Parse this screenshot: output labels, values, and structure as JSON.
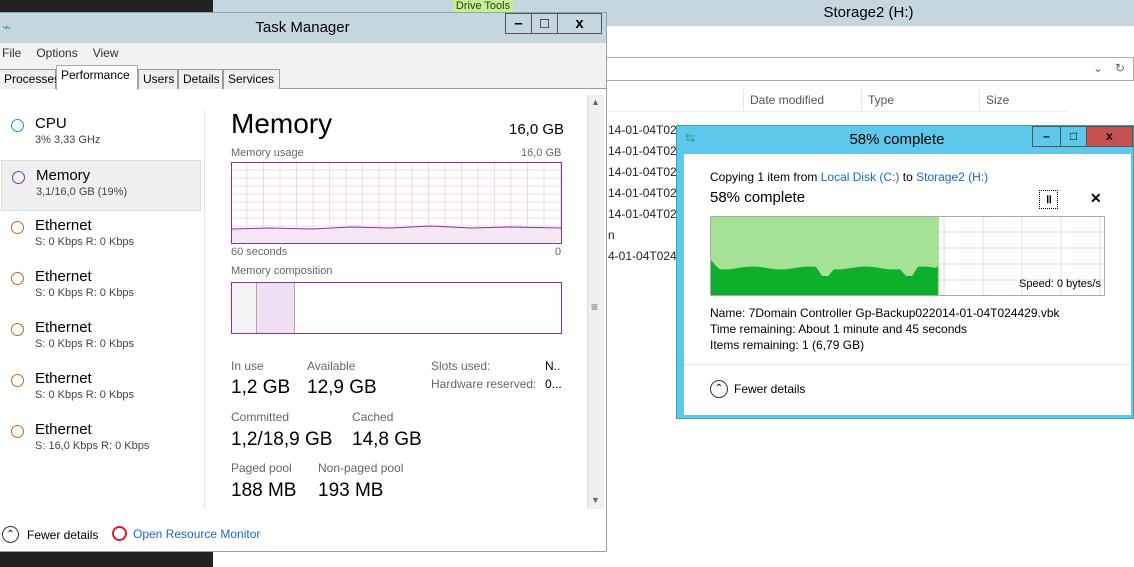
{
  "explorer": {
    "title": "Storage2 (H:)",
    "ribbon_tab": "Drive Tools",
    "columns": [
      "Date modified",
      "Type",
      "Size"
    ],
    "rows": [
      "14-01-04T024",
      "14-01-04T024",
      "14-01-04T024",
      "14-01-04T024",
      "14-01-04T024",
      "n",
      "4-01-04T0244"
    ]
  },
  "task_manager": {
    "title": "Task Manager",
    "menu": [
      "File",
      "Options",
      "View"
    ],
    "tabs": [
      "Processes",
      "Performance",
      "Users",
      "Details",
      "Services"
    ],
    "active_tab": "Performance",
    "sidebar": [
      {
        "name": "CPU",
        "sub": "3% 3,33 GHz",
        "color": "#1b90d8"
      },
      {
        "name": "Memory",
        "sub": "3,1/16,0 GB (19%)",
        "color": "#8b2fa8"
      },
      {
        "name": "Ethernet",
        "sub": "S: 0 Kbps R: 0 Kbps",
        "color": "#c8641e"
      },
      {
        "name": "Ethernet",
        "sub": "S: 0 Kbps R: 0 Kbps",
        "color": "#c8641e"
      },
      {
        "name": "Ethernet",
        "sub": "S: 0 Kbps R: 0 Kbps",
        "color": "#c8641e"
      },
      {
        "name": "Ethernet",
        "sub": "S: 0 Kbps R: 0 Kbps",
        "color": "#c8641e"
      },
      {
        "name": "Ethernet",
        "sub": "S: 16,0 Kbps R: 0 Kbps",
        "color": "#c8641e"
      }
    ],
    "memory": {
      "title": "Memory",
      "total": "16,0 GB",
      "usage_label": "Memory usage",
      "usage_max": "16,0 GB",
      "time_left": "60 seconds",
      "time_right": "0",
      "composition_label": "Memory composition",
      "in_use_label": "In use",
      "in_use": "1,2 GB",
      "available_label": "Available",
      "available": "12,9 GB",
      "committed_label": "Committed",
      "committed": "1,2/18,9 GB",
      "cached_label": "Cached",
      "cached": "14,8 GB",
      "paged_label": "Paged pool",
      "paged": "188 MB",
      "nonpaged_label": "Non-paged pool",
      "nonpaged": "193 MB",
      "slots_label": "Slots used:",
      "slots": "N..",
      "hw_label": "Hardware reserved:",
      "hw": "0..."
    },
    "footer": {
      "fewer": "Fewer details",
      "resmon": "Open Resource Monitor"
    }
  },
  "copy_dialog": {
    "title": "58% complete",
    "copying_prefix": "Copying 1 item from",
    "from": "Local Disk (C:)",
    "to_word": "to",
    "to": "Storage2 (H:)",
    "progress_text": "58% complete",
    "progress": 58,
    "speed": "Speed: 0 bytes/s",
    "name_label": "Name:",
    "name": "7Domain Controller Gp-Backup022014-01-04T024429.vbk",
    "time_label": "Time remaining:",
    "time": "About 1 minute and 45 seconds",
    "items_label": "Items remaining:",
    "items": "1 (6,79 GB)",
    "fewer": "Fewer details"
  }
}
